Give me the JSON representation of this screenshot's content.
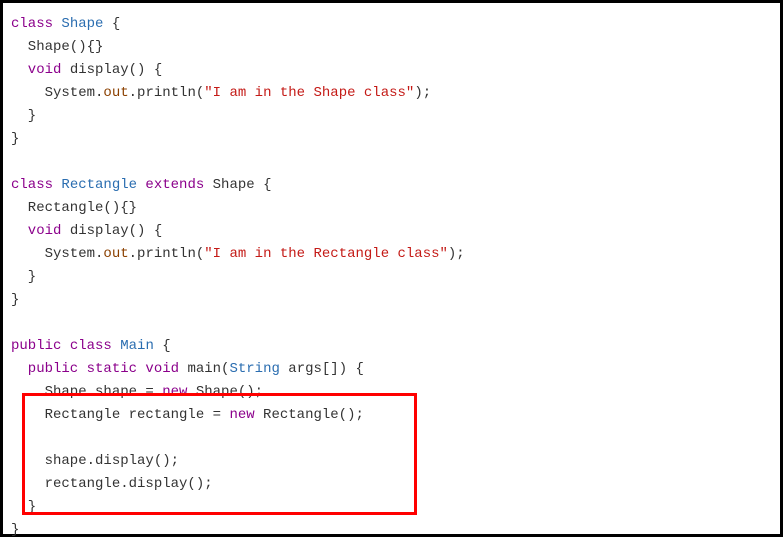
{
  "code": {
    "l1_class": "class",
    "l1_name": "Shape",
    "l1_brace": " {",
    "l2": "  Shape(){}",
    "l3_void": "  void",
    "l3_method": " display() {",
    "l4_sys": "    System.",
    "l4_out": "out",
    "l4_println": ".println(",
    "l4_str": "\"I am in the Shape class\"",
    "l4_end": ");",
    "l5": "  }",
    "l6": "}",
    "blank": "",
    "l8_class": "class",
    "l8_name": " Rectangle",
    "l8_extends": " extends",
    "l8_parent": " Shape",
    "l8_brace": " {",
    "l9": "  Rectangle(){}",
    "l10_void": "  void",
    "l10_method": " display() {",
    "l11_sys": "    System.",
    "l11_out": "out",
    "l11_println": ".println(",
    "l11_str": "\"I am in the Rectangle class\"",
    "l11_end": ");",
    "l12": "  }",
    "l13": "}",
    "l15_public": "public",
    "l15_class": " class",
    "l15_name": " Main",
    "l15_brace": " {",
    "l16_public": "  public",
    "l16_static": " static",
    "l16_void": " void",
    "l16_main": " main(",
    "l16_type": "String",
    "l16_args": " args[]) {",
    "l17_pre": "    Shape shape = ",
    "l17_new": "new",
    "l17_post": " Shape();",
    "l18_pre": "    Rectangle rectangle = ",
    "l18_new": "new",
    "l18_post": " Rectangle();",
    "l20": "    shape.display();",
    "l21": "    rectangle.display();",
    "l22": "  }",
    "l23": "}"
  }
}
